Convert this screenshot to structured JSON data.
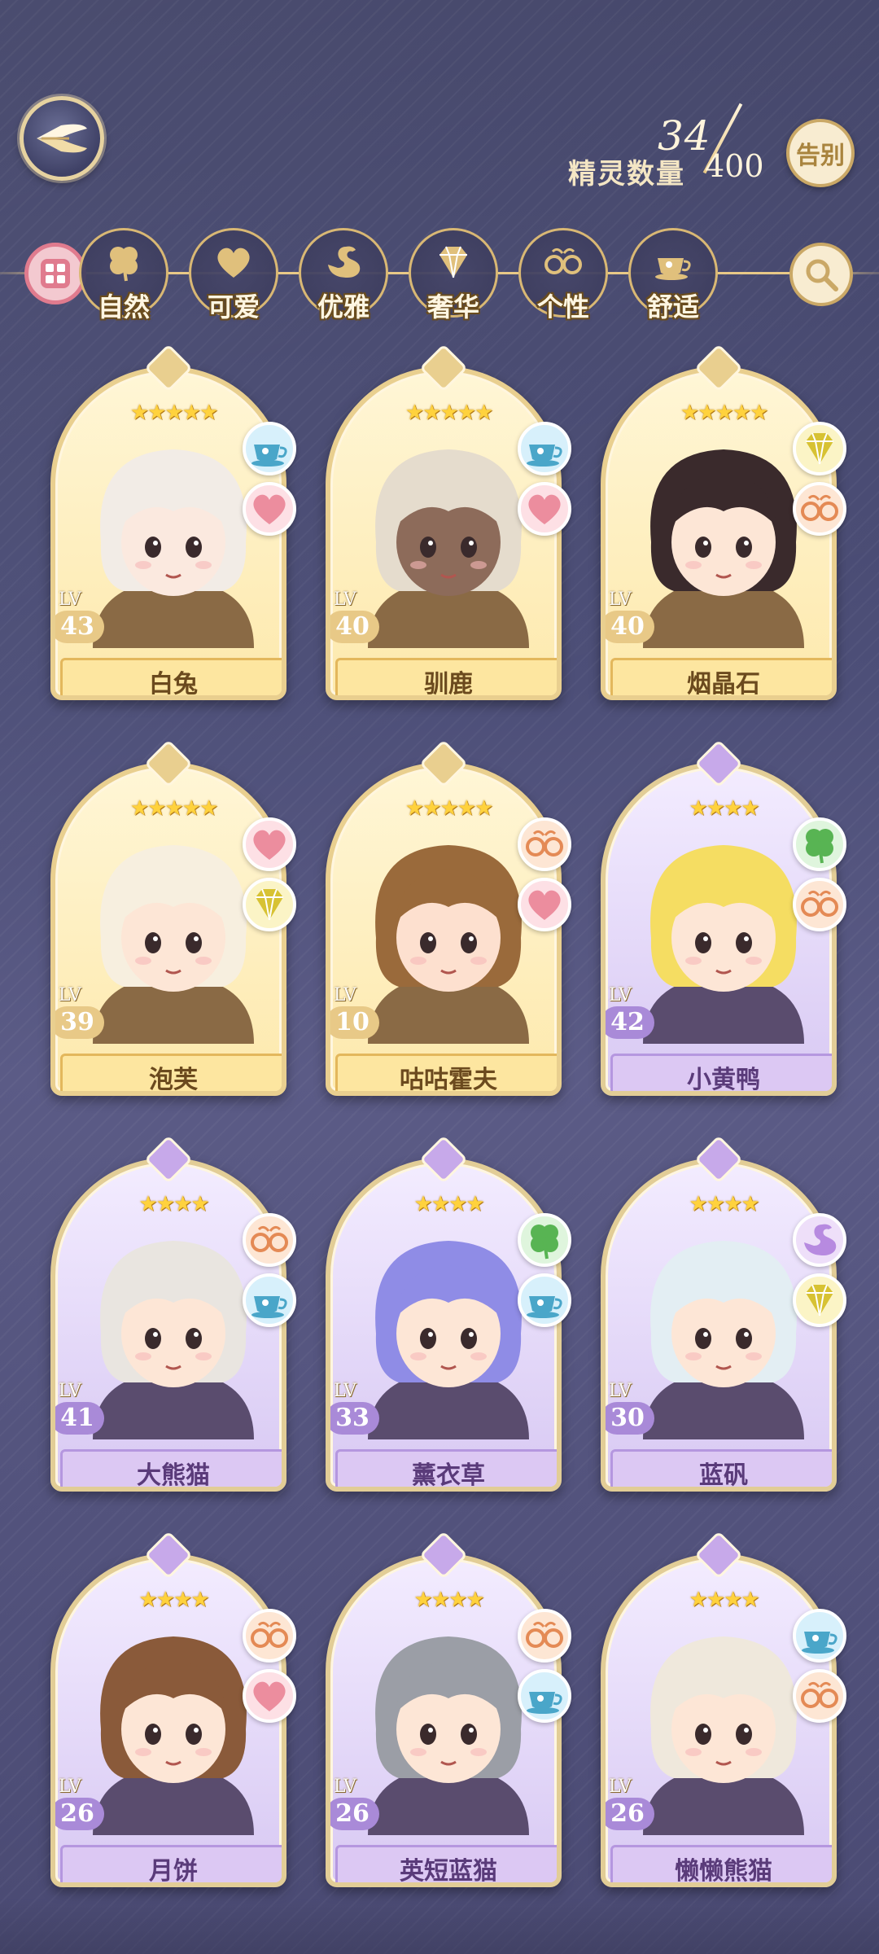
{
  "header": {
    "count_label": "精灵数量",
    "count_current": "34",
    "count_total": "400",
    "farewell_label": "告别"
  },
  "filters": [
    {
      "label": "自然",
      "icon": "clover-icon"
    },
    {
      "label": "可爱",
      "icon": "heart-icon"
    },
    {
      "label": "优雅",
      "icon": "swan-icon"
    },
    {
      "label": "奢华",
      "icon": "diamond-icon"
    },
    {
      "label": "个性",
      "icon": "glasses-icon"
    },
    {
      "label": "舒适",
      "icon": "teacup-icon"
    }
  ],
  "sprites": [
    {
      "name": "白兔",
      "level": "43",
      "lv_label": "LV",
      "stars": "★★★★★",
      "theme": "gold",
      "badges": [
        "teacup",
        "heart"
      ],
      "hair": "#f2ece6",
      "skin": "#fbe9df"
    },
    {
      "name": "驯鹿",
      "level": "40",
      "lv_label": "LV",
      "stars": "★★★★★",
      "theme": "gold",
      "badges": [
        "teacup",
        "heart"
      ],
      "hair": "#e5dccd",
      "skin": "#8d6b5a"
    },
    {
      "name": "烟晶石",
      "level": "40",
      "lv_label": "LV",
      "stars": "★★★★★",
      "theme": "gold",
      "badges": [
        "diamond",
        "glasses"
      ],
      "hair": "#3a2a2c",
      "skin": "#fde6d6"
    },
    {
      "name": "泡芙",
      "level": "39",
      "lv_label": "LV",
      "stars": "★★★★★",
      "theme": "gold",
      "badges": [
        "heart",
        "diamond"
      ],
      "hair": "#f7efdf",
      "skin": "#fde6d6"
    },
    {
      "name": "咕咕霍夫",
      "level": "10",
      "lv_label": "LV",
      "stars": "★★★★★",
      "theme": "gold",
      "badges": [
        "glasses",
        "heart"
      ],
      "hair": "#9a6a3b",
      "skin": "#fde0cf"
    },
    {
      "name": "小黄鸭",
      "level": "42",
      "lv_label": "LV",
      "stars": "★★★★",
      "theme": "purple",
      "badges": [
        "clover",
        "glasses"
      ],
      "hair": "#f5dd62",
      "skin": "#fde6d6"
    },
    {
      "name": "大熊猫",
      "level": "41",
      "lv_label": "LV",
      "stars": "★★★★",
      "theme": "purple",
      "badges": [
        "glasses",
        "teacup"
      ],
      "hair": "#e9e5e0",
      "skin": "#fde6d6"
    },
    {
      "name": "薰衣草",
      "level": "33",
      "lv_label": "LV",
      "stars": "★★★★",
      "theme": "purple",
      "badges": [
        "clover",
        "teacup"
      ],
      "hair": "#8f8ce6",
      "skin": "#fde6d6"
    },
    {
      "name": "蓝矾",
      "level": "30",
      "lv_label": "LV",
      "stars": "★★★★",
      "theme": "purple",
      "badges": [
        "swan",
        "diamond"
      ],
      "hair": "#e3eef3",
      "skin": "#fde6d6"
    },
    {
      "name": "月饼",
      "level": "26",
      "lv_label": "LV",
      "stars": "★★★★",
      "theme": "purple",
      "badges": [
        "glasses",
        "heart"
      ],
      "hair": "#8a5a3a",
      "skin": "#fde6d6"
    },
    {
      "name": "英短蓝猫",
      "level": "26",
      "lv_label": "LV",
      "stars": "★★★★",
      "theme": "purple",
      "badges": [
        "glasses",
        "teacup"
      ],
      "hair": "#9b9ea6",
      "skin": "#fde6d6"
    },
    {
      "name": "懒懒熊猫",
      "level": "26",
      "lv_label": "LV",
      "stars": "★★★★",
      "theme": "purple",
      "badges": [
        "teacup",
        "glasses"
      ],
      "hair": "#efe8dc",
      "skin": "#fde6d6"
    }
  ],
  "colors": {
    "bg": "#4d4f78",
    "gold_accent": "#e8c987",
    "purple_accent": "#a98ad8"
  }
}
